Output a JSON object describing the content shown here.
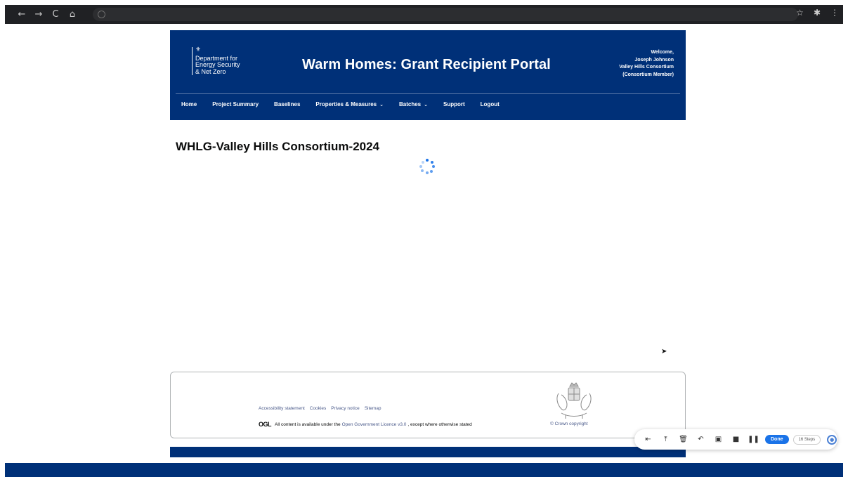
{
  "browser": {
    "back_icon": "←",
    "forward_icon": "→",
    "reload_icon": "C",
    "home_icon": "⌂",
    "bookmark_icon": "☆",
    "extensions_icon": "✱",
    "menu_icon": "⋮"
  },
  "header": {
    "dept_line1": "Department for",
    "dept_line2": "Energy Security",
    "dept_line3": "& Net Zero",
    "title": "Warm Homes: Grant Recipient Portal",
    "welcome_line1": "Welcome,",
    "welcome_line2": "Joseph Johnson",
    "welcome_line3": "Valley Hills Consortium",
    "welcome_line4": "(Consortium Member)"
  },
  "nav": {
    "home": "Home",
    "project_summary": "Project Summary",
    "baselines": "Baselines",
    "properties_measures": "Properties & Measures",
    "batches": "Batches",
    "support": "Support",
    "logout": "Logout"
  },
  "main": {
    "page_title": "WHLG-Valley Hills Consortium-2024"
  },
  "footer": {
    "links": [
      "Accessibility statement",
      "Cookies",
      "Privacy notice",
      "Sitemap"
    ],
    "ogl_logo": "OGL",
    "licence_prefix": "All content is available under the",
    "licence_link": "Open Government Licence v3.0",
    "licence_suffix": ", except where otherwise stated",
    "crown_copyright": "© Crown copyright"
  },
  "recorder": {
    "done_label": "Done",
    "steps_label": "16 Steps"
  },
  "colors": {
    "brand_blue": "#003078",
    "accent_blue": "#1a73e8"
  }
}
